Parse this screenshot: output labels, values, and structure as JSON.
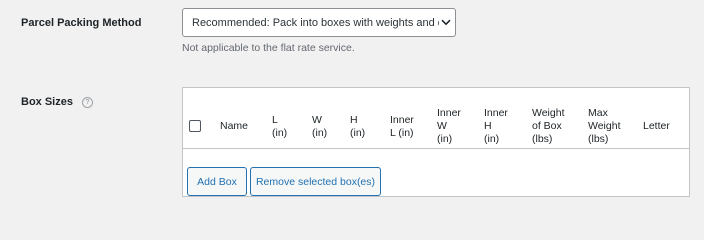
{
  "packing": {
    "label": "Parcel Packing Method",
    "selected": "Recommended: Pack into boxes with weights and dimensions",
    "hint": "Not applicable to the flat rate service."
  },
  "boxes": {
    "label": "Box Sizes",
    "help_icon": "?",
    "columns": [
      "Name",
      "L\n(in)",
      "W\n(in)",
      "H\n(in)",
      "Inner\nL (in)",
      "Inner\nW\n(in)",
      "Inner\nH\n(in)",
      "Weight\nof Box\n(lbs)",
      "Max\nWeight\n(lbs)",
      "Letter"
    ],
    "add_label": "Add Box",
    "remove_label": "Remove selected box(es)"
  }
}
